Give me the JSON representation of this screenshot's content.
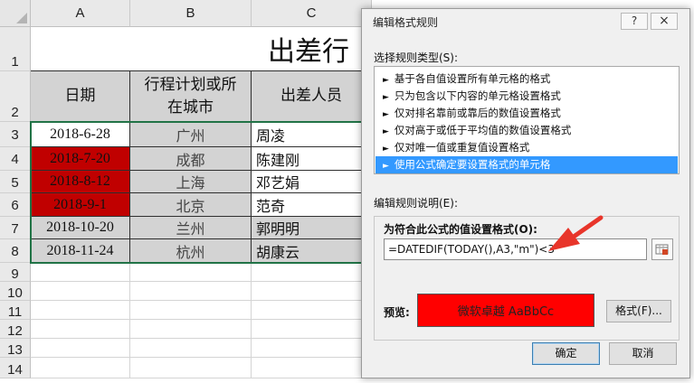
{
  "sheet": {
    "columns": [
      "A",
      "B",
      "C"
    ],
    "rows": [
      "1",
      "2",
      "3",
      "4",
      "5",
      "6",
      "7",
      "8",
      "9",
      "10",
      "11",
      "12",
      "13",
      "14"
    ],
    "title": "出差行",
    "headers": {
      "date": "日期",
      "city_line1": "行程计划或所",
      "city_line2": "在城市",
      "person": "出差人员"
    },
    "records": [
      {
        "date": "2018-6-28",
        "city": "广州",
        "person": "周凌",
        "highlight": false
      },
      {
        "date": "2018-7-20",
        "city": "成都",
        "person": "陈建刚",
        "highlight": true
      },
      {
        "date": "2018-8-12",
        "city": "上海",
        "person": "邓艺娟",
        "highlight": true
      },
      {
        "date": "2018-9-1",
        "city": "北京",
        "person": "范奇",
        "highlight": true
      },
      {
        "date": "2018-10-20",
        "city": "兰州",
        "person": "郭明明",
        "highlight": false
      },
      {
        "date": "2018-11-24",
        "city": "杭州",
        "person": "胡康云",
        "highlight": false
      }
    ],
    "colors": {
      "highlight": "#c00000",
      "gray": "#d3d3d3",
      "selection": "#217346"
    }
  },
  "dialog": {
    "title": "编辑格式规则",
    "help": "?",
    "close": "×",
    "select_type_label": "选择规则类型(S):",
    "rule_types": [
      "基于各自值设置所有单元格的格式",
      "只为包含以下内容的单元格设置格式",
      "仅对排名靠前或靠后的数值设置格式",
      "仅对高于或低于平均值的数值设置格式",
      "仅对唯一值或重复值设置格式",
      "使用公式确定要设置格式的单元格"
    ],
    "selected_rule_index": 5,
    "edit_desc_label": "编辑规则说明(E):",
    "formula_label": "为符合此公式的值设置格式(O):",
    "formula": "=DATEDIF(TODAY(),A3,\"m\")<3",
    "preview_label": "预览:",
    "preview_text": "微软卓越  AaBbCc",
    "preview_color": "#ff0000",
    "format_button": "格式(F)...",
    "ok_button": "确定",
    "cancel_button": "取消"
  },
  "annotation": {
    "arrow_color": "#e8352a",
    "icon": "red-arrow-icon"
  }
}
